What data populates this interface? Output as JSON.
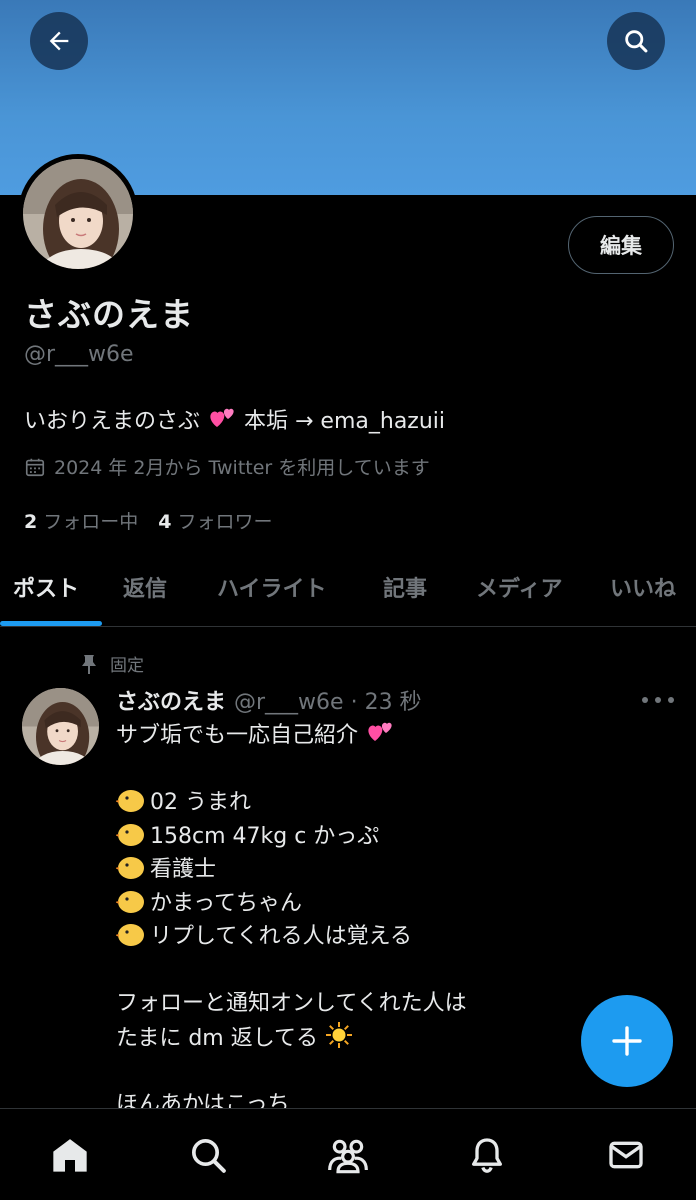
{
  "header": {
    "back_icon": "arrow-left-icon",
    "search_icon": "search-icon"
  },
  "profile": {
    "display_name": "さぶのえま",
    "handle": "@r___w6e",
    "edit_label": "編集",
    "bio_text": "いおりえまのさぶ",
    "bio_emoji": "two-hearts-icon",
    "bio_suffix": "本垢 → ema_hazuii",
    "joined": "2024 年 2月から Twitter を利用しています",
    "following_count": "2",
    "following_label": "フォロー中",
    "followers_count": "4",
    "followers_label": "フォロワー"
  },
  "tabs": [
    {
      "label": "ポスト",
      "active": true
    },
    {
      "label": "返信",
      "active": false
    },
    {
      "label": "ハイライト",
      "active": false
    },
    {
      "label": "記事",
      "active": false
    },
    {
      "label": "メディア",
      "active": false
    },
    {
      "label": "いいね",
      "active": false
    }
  ],
  "post": {
    "pinned_label": "固定",
    "author_name": "さぶのえま",
    "author_meta": "@r___w6e · 23 秒",
    "lines": [
      "サブ垢でも一応自己紹介",
      "",
      "02 うまれ",
      "158cm 47kg c かっぷ",
      "看護士",
      "かまってちゃん",
      "リプしてくれる人は覚える",
      "",
      "フォローと通知オンしてくれた人は",
      "たまに dm 返してる",
      "",
      "ほんあかはこっち"
    ]
  },
  "colors": {
    "accent": "#1d9bf0",
    "banner_top": "#3a79b8",
    "banner_bottom": "#4f9ce0",
    "muted_text": "#71767b",
    "text": "#e7e9ea",
    "background": "#000000"
  },
  "bottom_nav": [
    {
      "icon": "home-icon"
    },
    {
      "icon": "search-icon"
    },
    {
      "icon": "communities-icon"
    },
    {
      "icon": "bell-icon"
    },
    {
      "icon": "mail-icon"
    }
  ]
}
